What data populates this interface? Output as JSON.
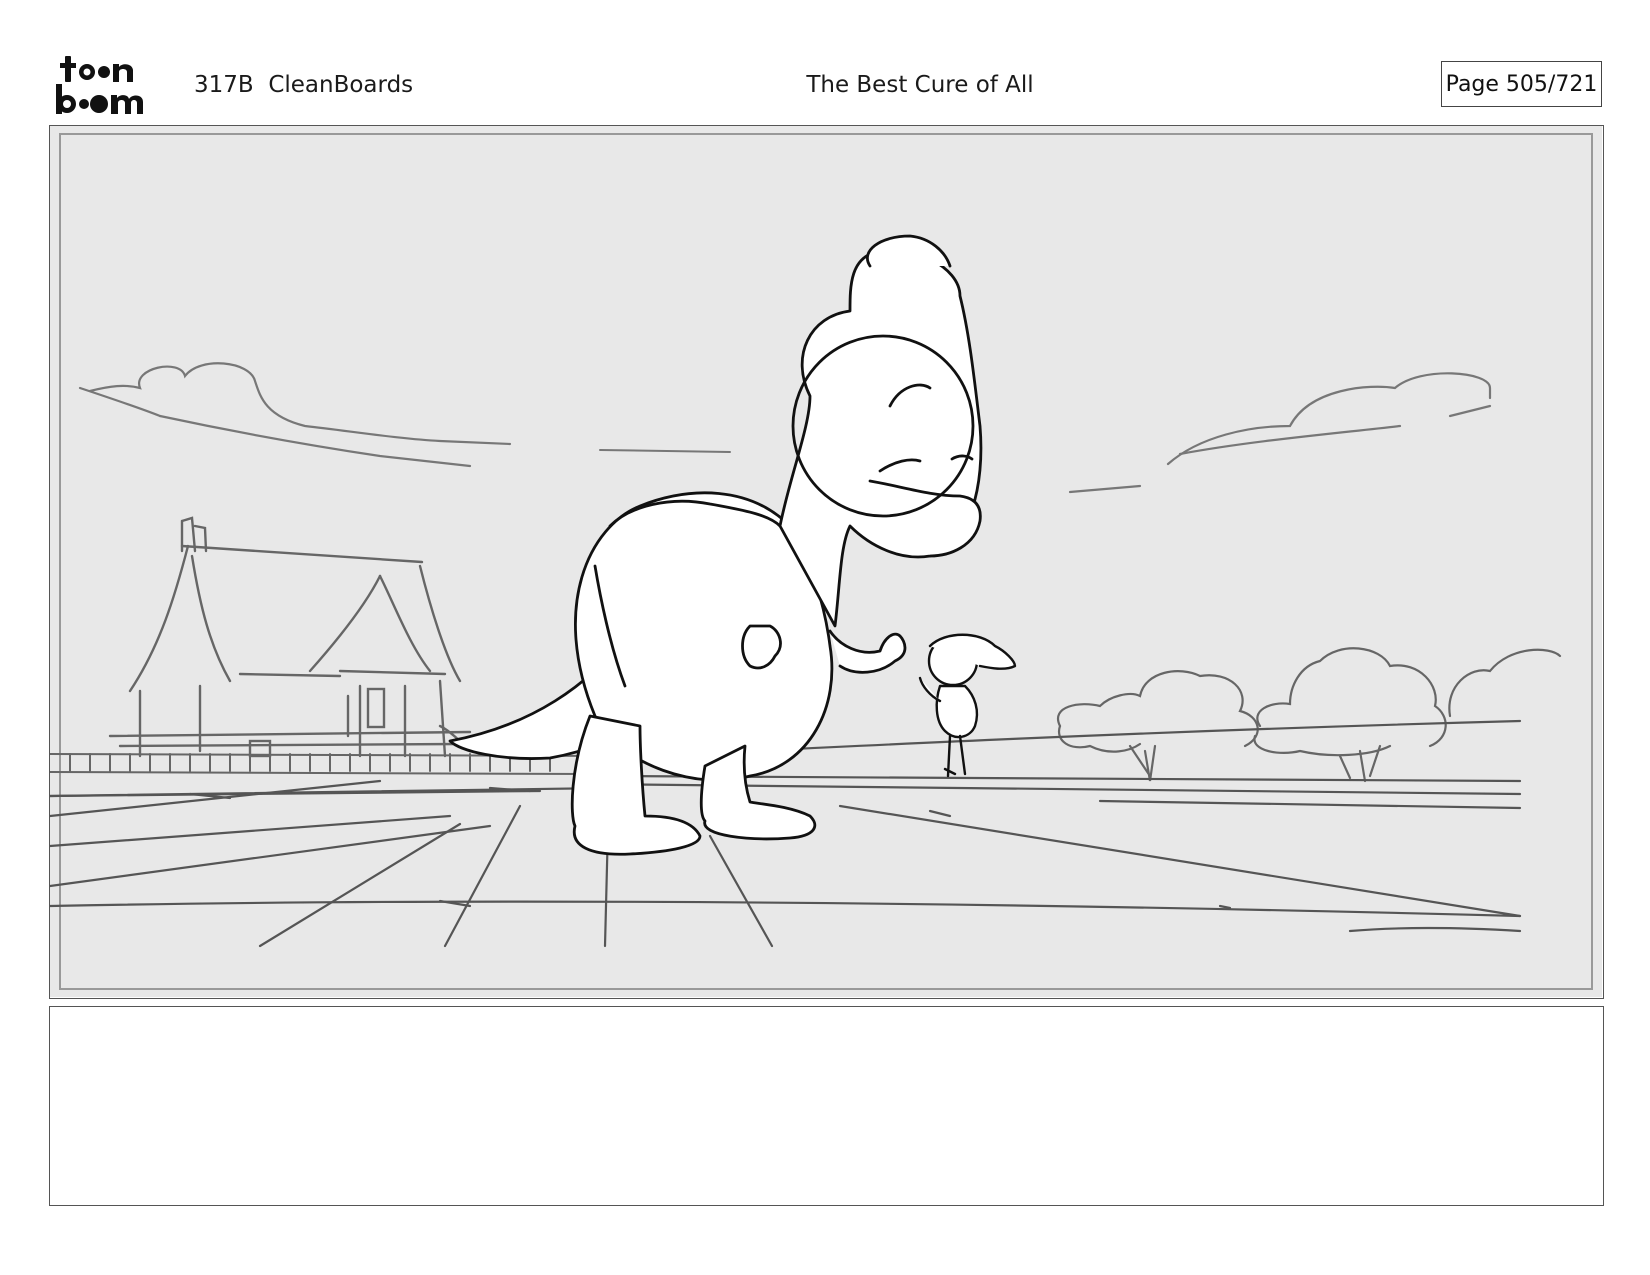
{
  "header": {
    "logo_text": "toon boom",
    "episode": "317B",
    "section": "CleanBoards",
    "title": "The Best Cure of All",
    "page": "Page 505/721"
  },
  "panel": {
    "description_icons": [
      "dinosaur-character",
      "small-character",
      "house",
      "trees",
      "clouds",
      "fence"
    ]
  },
  "notes": {
    "text": ""
  }
}
